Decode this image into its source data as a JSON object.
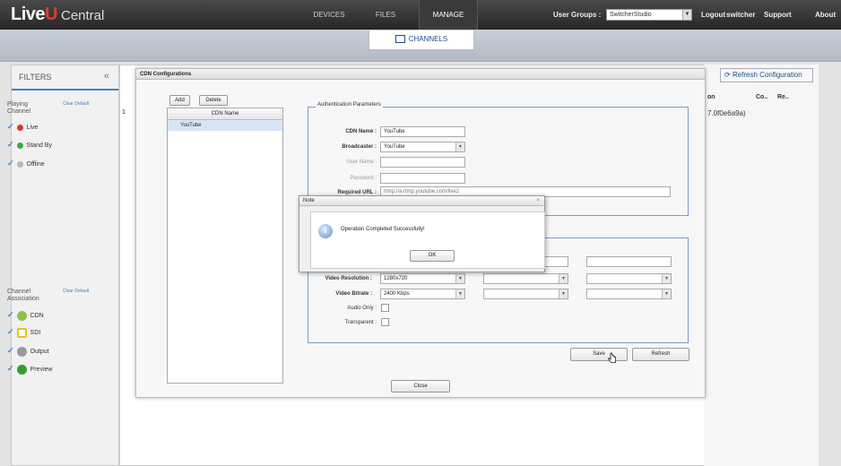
{
  "header": {
    "logo": "LiveU Central",
    "nav": [
      "DEVICES",
      "FILES",
      "MANAGE"
    ],
    "active_nav": "MANAGE",
    "user_groups_label": "User Groups :",
    "user_group_value": "SwitcherStudio",
    "logout": "Logout",
    "username": "switcher",
    "support": "Support",
    "about": "About"
  },
  "subnav": {
    "channels": "CHANNELS"
  },
  "filters": {
    "title": "FILTERS",
    "playing_channel": {
      "title": "Playing Channel",
      "clear": "Clear",
      "default": "Default",
      "items": [
        {
          "label": "Live",
          "color": "#e0332b"
        },
        {
          "label": "Stand By",
          "color": "#3faa3f"
        },
        {
          "label": "Offline",
          "color": "#b8b8b8"
        }
      ]
    },
    "channel_association": {
      "title": "Channel Association",
      "clear": "Clear",
      "default": "Default",
      "items": [
        {
          "label": "CDN",
          "color": "#8bc34a"
        },
        {
          "label": "SDI",
          "color": "#e8c020"
        },
        {
          "label": "Output",
          "color": "#9a9a9a"
        },
        {
          "label": "Preview",
          "color": "#33a033"
        }
      ]
    }
  },
  "right_pane": {
    "refresh_configuration": "Refresh Configuration",
    "col_on": "on",
    "col_co": "Co..",
    "col_re": "Re..",
    "row_value": "7.0f0e6a9a)",
    "row_index": "1"
  },
  "dialog": {
    "title": "CDN Configurations",
    "add": "Add",
    "delete": "Delete",
    "list_header": "CDN Name",
    "list_items": [
      "YouTube"
    ],
    "auth_legend": "Authentication Parameters",
    "cdn_name_label": "CDN Name :",
    "cdn_name_value": "YouTube",
    "broadcaster_label": "Broadcaster :",
    "broadcaster_value": "YouTube",
    "user_name_label": "User Name :",
    "password_label": "Password :",
    "required_url_label": "Required URL :",
    "required_url_value": "rtmp://a.rtmp.youtube.com/live2",
    "video_resolution_label": "Video Resolution :",
    "video_resolution_value": "1280x720",
    "video_bitrate_label": "Video Bitrate :",
    "video_bitrate_value": "2400 Kbps",
    "audio_only_label": "Audio Only :",
    "transparent_label": "Transparent :",
    "save": "Save",
    "refresh": "Refresh",
    "close": "Close"
  },
  "note": {
    "title": "Note",
    "message": "Operation Completed Successfully!",
    "ok": "OK"
  }
}
